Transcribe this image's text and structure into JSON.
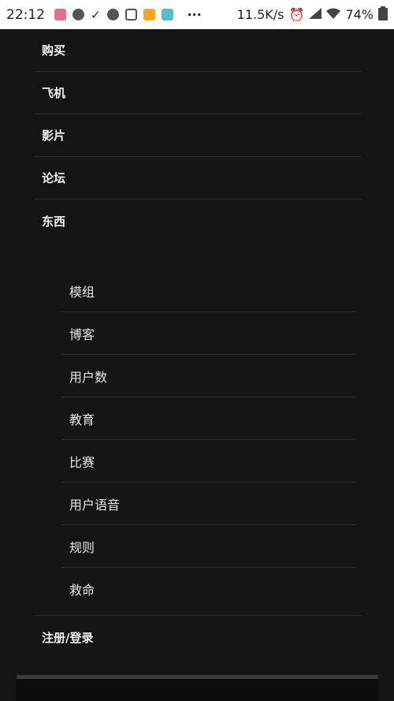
{
  "status_bar": {
    "time": "22:12",
    "network_speed": "11.5K/s",
    "battery": "74%",
    "more_indicator": "···",
    "icons": [
      "shop-icon",
      "wechat-icon",
      "download-done-icon",
      "wechat-icon",
      "alarm-face-icon",
      "orange-app-icon",
      "teal-app-icon"
    ]
  },
  "menu": {
    "items": [
      {
        "label": "购买"
      },
      {
        "label": "飞机"
      },
      {
        "label": "影片"
      },
      {
        "label": "论坛"
      },
      {
        "label": "东西"
      }
    ],
    "submenu": [
      {
        "label": "模组"
      },
      {
        "label": "博客"
      },
      {
        "label": "用户数"
      },
      {
        "label": "教育"
      },
      {
        "label": "比赛"
      },
      {
        "label": "用户语音"
      },
      {
        "label": "规则"
      },
      {
        "label": "救命"
      }
    ],
    "login_label": "注册/登录"
  },
  "colors": {
    "drawer_bg": "#141414",
    "divider": "#2a2a2a",
    "text": "#f0f0f0"
  }
}
